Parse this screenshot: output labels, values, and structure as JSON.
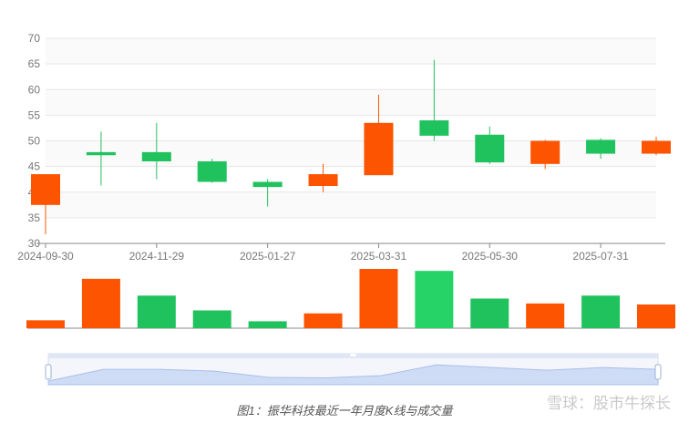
{
  "chart_data": {
    "type": "candlestick",
    "title": "",
    "ylim": [
      30,
      70
    ],
    "y_ticks": [
      30,
      35,
      40,
      45,
      50,
      55,
      60,
      65,
      70
    ],
    "x_tick_labels": [
      "2024-09-30",
      "2024-11-29",
      "2025-01-27",
      "2025-03-31",
      "2025-05-30",
      "2025-07-31"
    ],
    "x_tick_label_positions": [
      0,
      2,
      4,
      6,
      8,
      10
    ],
    "up_color": "#fc5400",
    "down_color": "#20c25e",
    "candles": [
      {
        "open": 37.5,
        "close": 43.5,
        "high": 43.5,
        "low": 31.8
      },
      {
        "open": 47.8,
        "close": 47.2,
        "high": 51.8,
        "low": 41.3
      },
      {
        "open": 47.8,
        "close": 46.0,
        "high": 53.5,
        "low": 42.5
      },
      {
        "open": 46.0,
        "close": 42.0,
        "high": 46.5,
        "low": 41.8
      },
      {
        "open": 42.0,
        "close": 41.0,
        "high": 42.5,
        "low": 37.2
      },
      {
        "open": 41.2,
        "close": 43.5,
        "high": 45.5,
        "low": 40.0
      },
      {
        "open": 43.3,
        "close": 53.5,
        "high": 59.0,
        "low": 43.3
      },
      {
        "open": 54.0,
        "close": 51.0,
        "high": 65.8,
        "low": 50.0
      },
      {
        "open": 51.2,
        "close": 45.8,
        "high": 52.8,
        "low": 45.5
      },
      {
        "open": 45.5,
        "close": 50.0,
        "high": 50.2,
        "low": 44.5
      },
      {
        "open": 50.2,
        "close": 47.5,
        "high": 50.5,
        "low": 46.5
      },
      {
        "open": 47.5,
        "close": 50.0,
        "high": 50.8,
        "low": 47.2
      }
    ],
    "volume": {
      "values": [
        8,
        50,
        33,
        18,
        7,
        15,
        60,
        58,
        30,
        25,
        33,
        24
      ],
      "colors": [
        "#fc5400",
        "#fc5400",
        "#20c25e",
        "#20c25e",
        "#20c25e",
        "#fc5400",
        "#fc5400",
        "#25d366",
        "#20c25e",
        "#fc5400",
        "#20c25e",
        "#fc5400"
      ]
    },
    "navigator": {
      "start_fraction": 0,
      "end_fraction": 1,
      "area_values": [
        0.1,
        0.75,
        0.75,
        0.65,
        0.3,
        0.28,
        0.4,
        1.0,
        0.85,
        0.7,
        0.85,
        0.75
      ]
    }
  },
  "caption": "图1：振华科技最近一年月度K线与成交量",
  "watermark": "雪球：股市牛探长"
}
